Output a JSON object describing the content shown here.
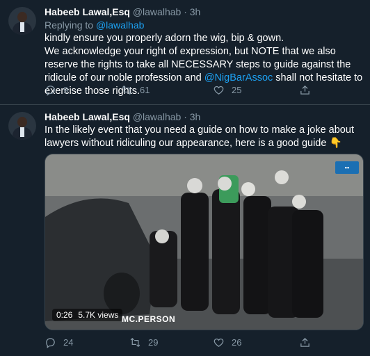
{
  "tweets": [
    {
      "name": "Habeeb Lawal,Esq",
      "handle": "@lawalhab",
      "dot": "·",
      "time": "3h",
      "replying_prefix": "Replying to",
      "replying_handle": "@lawalhab",
      "text_line1": "kindly ensure you properly adorn the wig, bip & gown.",
      "text_line2": "We acknowledge your right of expression, but NOTE that we also reserve the rights to take all NECESSARY steps to guide against the ridicule of our noble profession and ",
      "mention": "@NigBarAssoc",
      "text_line3": " shall not hesitate to exercise those rights.",
      "replies": "9",
      "retweets": "61",
      "likes": "25"
    },
    {
      "name": "Habeeb Lawal,Esq",
      "handle": "@lawalhab",
      "dot": "·",
      "time": "3h",
      "text": "In the likely event that you need a guide on how to make a joke about lawyers without ridiculing our appearance, here is a good guide 👇",
      "video": {
        "duration": "0:26",
        "views": "5.7K views",
        "caption": "MC.PERSON"
      },
      "replies": "24",
      "retweets": "29",
      "likes": "26"
    }
  ],
  "icons": {
    "reply": "reply-icon",
    "retweet": "retweet-icon",
    "like": "heart-icon",
    "share": "share-icon"
  },
  "colors": {
    "background": "#15202b",
    "link": "#1da1f2",
    "muted": "#8899a6",
    "divider": "#38444d"
  }
}
